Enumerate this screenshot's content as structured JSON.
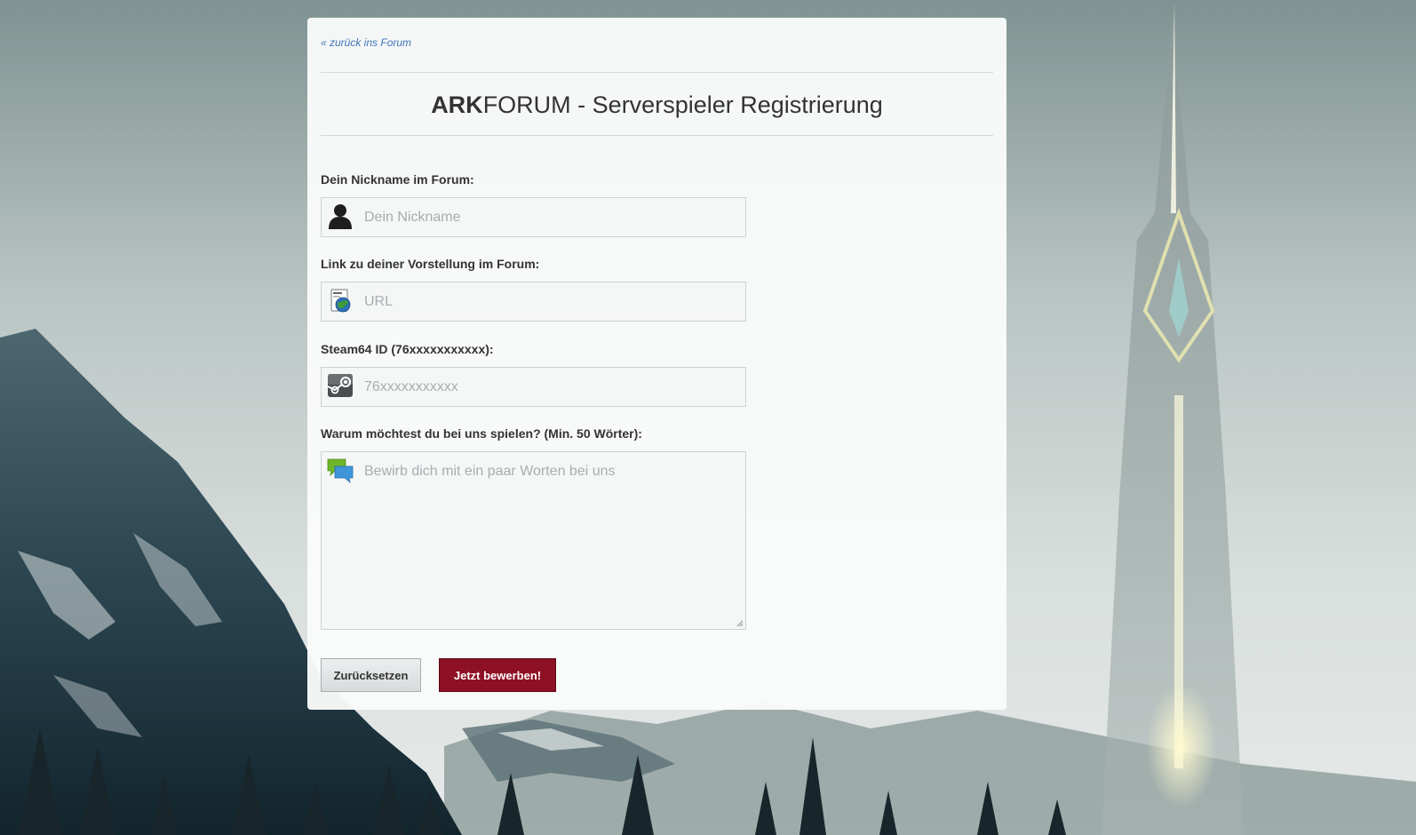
{
  "back_link": "« zurück ins Forum",
  "title": {
    "brand_bold": "ARK",
    "brand_rest": "FORUM",
    "rest": " - Serverspieler Registrierung"
  },
  "fields": {
    "nickname": {
      "label": "Dein Nickname im Forum:",
      "placeholder": "Dein Nickname",
      "icon": "user-icon"
    },
    "url": {
      "label": "Link zu deiner Vorstellung im Forum:",
      "placeholder": "URL",
      "icon": "web-document-icon"
    },
    "steam": {
      "label": "Steam64 ID (76xxxxxxxxxxx):",
      "placeholder": "76xxxxxxxxxxx",
      "icon": "steam-icon"
    },
    "reason": {
      "label": "Warum möchtest du bei uns spielen? (Min. 50 Wörter):",
      "placeholder": "Bewirb dich mit ein paar Worten bei uns",
      "icon": "chat-bubbles-icon"
    }
  },
  "buttons": {
    "reset": "Zurücksetzen",
    "submit": "Jetzt bewerben!"
  },
  "colors": {
    "link": "#3f74b7",
    "submit_button": "#8e1024"
  }
}
